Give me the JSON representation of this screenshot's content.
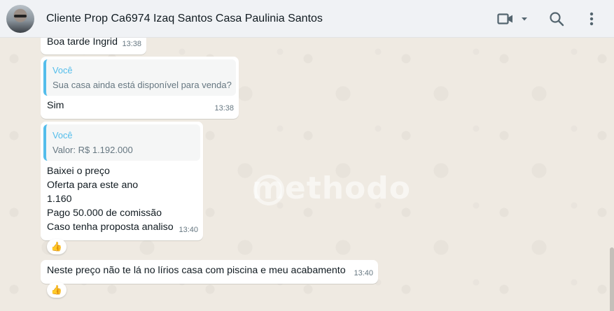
{
  "header": {
    "title": "Cliente Prop Ca6974 Izaq Santos Casa Paulinia Santos",
    "icons": [
      "video-call-icon",
      "chevron-down-icon",
      "search-icon",
      "more-options-icon"
    ]
  },
  "watermark": "methodo",
  "messages": [
    {
      "text": "Boa tarde Ingrid",
      "time": "13:38"
    },
    {
      "quote_author": "Você",
      "quote_text": "Sua casa ainda está disponível para venda?",
      "text": "Sim",
      "time": "13:38"
    },
    {
      "quote_author": "Você",
      "quote_text": "Valor: R$ 1.192.000",
      "lines": [
        "Baixei o preço",
        "Oferta para este ano",
        "1.160",
        "Pago 50.000 de comissão",
        "Caso tenha proposta analiso"
      ],
      "time": "13:40",
      "reaction": "👍"
    },
    {
      "text": "Neste preço não te lá no lírios casa com piscina e meu acabamento",
      "time": "13:40",
      "reaction": "👍"
    }
  ]
}
